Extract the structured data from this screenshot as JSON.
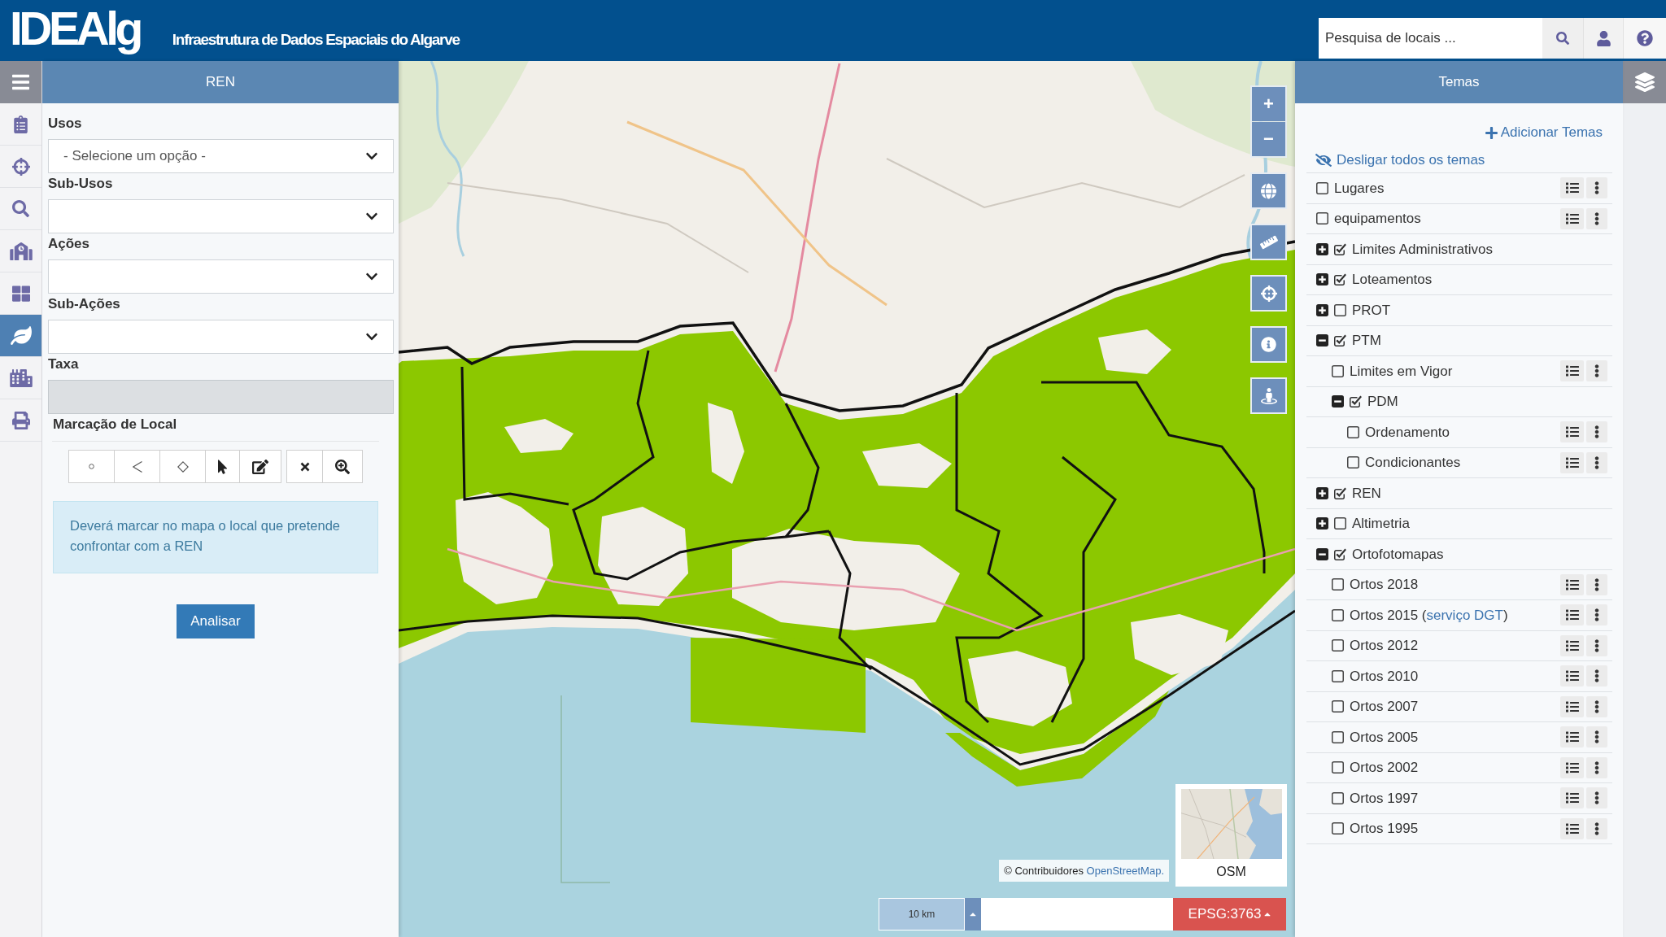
{
  "header": {
    "logo": "IDEAlg",
    "subtitle": "Infraestrutura de Dados Espaciais do Algarve",
    "search": {
      "placeholder": "Pesquisa de locais ..."
    }
  },
  "rail": {
    "items": [
      {
        "selected": false
      },
      {
        "selected": false
      },
      {
        "selected": false
      },
      {
        "selected": false
      },
      {
        "selected": false
      },
      {
        "selected": true
      },
      {
        "selected": false
      },
      {
        "selected": false
      }
    ]
  },
  "left_panel": {
    "title": "REN",
    "fields": [
      {
        "kind": "select",
        "label": "Usos",
        "value": "- Selecione um opção -",
        "disabled": false
      },
      {
        "kind": "select",
        "label": "Sub-Usos",
        "disabled": false
      },
      {
        "kind": "select",
        "label": "Ações",
        "disabled": false
      },
      {
        "kind": "select",
        "label": "Sub-Ações",
        "disabled": false
      },
      {
        "kind": "input",
        "label": "Taxa",
        "disabled": true
      }
    ],
    "marking": {
      "title": "Marcação de Local"
    },
    "info": "Deverá marcar no mapa o local que pretende confrontar com a REN",
    "submit": "Analisar"
  },
  "map": {
    "zoom_in": "+",
    "zoom_out": "−",
    "attribution": {
      "text": "© Contribuidores",
      "link": "OpenStreetMap."
    },
    "basemap": {
      "label": "OSM"
    },
    "scale": "10 km",
    "projection": "EPSG:3763"
  },
  "themes": {
    "title": "Temas",
    "add": "Adicionar Temas",
    "hide_all": "Desligar todos os temas",
    "items": [
      {
        "kind": "layer",
        "label": "Lugares",
        "checked": false
      },
      {
        "kind": "layer",
        "label": "equipamentos",
        "checked": false
      },
      {
        "kind": "group",
        "label": "Limites Administrativos",
        "checked": true,
        "expanded": false
      },
      {
        "kind": "group",
        "label": "Loteamentos",
        "checked": true,
        "expanded": false
      },
      {
        "kind": "group",
        "label": "PROT",
        "checked": false,
        "expanded": false
      },
      {
        "kind": "group",
        "label": "PTM",
        "checked": true,
        "expanded": true,
        "children": [
          {
            "kind": "layer",
            "label": "Limites em Vigor",
            "checked": false
          },
          {
            "kind": "group",
            "label": "PDM",
            "checked": true,
            "expanded": true,
            "children": [
              {
                "kind": "layer",
                "label": "Ordenamento",
                "checked": false
              },
              {
                "kind": "layer",
                "label": "Condicionantes",
                "checked": false
              }
            ]
          }
        ]
      },
      {
        "kind": "group",
        "label": "REN",
        "checked": true,
        "expanded": false
      },
      {
        "kind": "group",
        "label": "Altimetria",
        "checked": false,
        "expanded": false
      },
      {
        "kind": "group",
        "label": "Ortofotomapas",
        "checked": true,
        "expanded": true,
        "children": [
          {
            "kind": "layer",
            "label": "Ortos 2018",
            "checked": false
          },
          {
            "kind": "layer",
            "label": "Ortos 2015 (",
            "link": "serviço DGT",
            "label_end": ")",
            "checked": false
          },
          {
            "kind": "layer",
            "label": "Ortos 2012",
            "checked": false
          },
          {
            "kind": "layer",
            "label": "Ortos 2010",
            "checked": false
          },
          {
            "kind": "layer",
            "label": "Ortos 2007",
            "checked": false
          },
          {
            "kind": "layer",
            "label": "Ortos 2005",
            "checked": false
          },
          {
            "kind": "layer",
            "label": "Ortos 2002",
            "checked": false
          },
          {
            "kind": "layer",
            "label": "Ortos 1997",
            "checked": false
          },
          {
            "kind": "layer",
            "label": "Ortos 1995",
            "checked": false
          }
        ]
      }
    ]
  }
}
